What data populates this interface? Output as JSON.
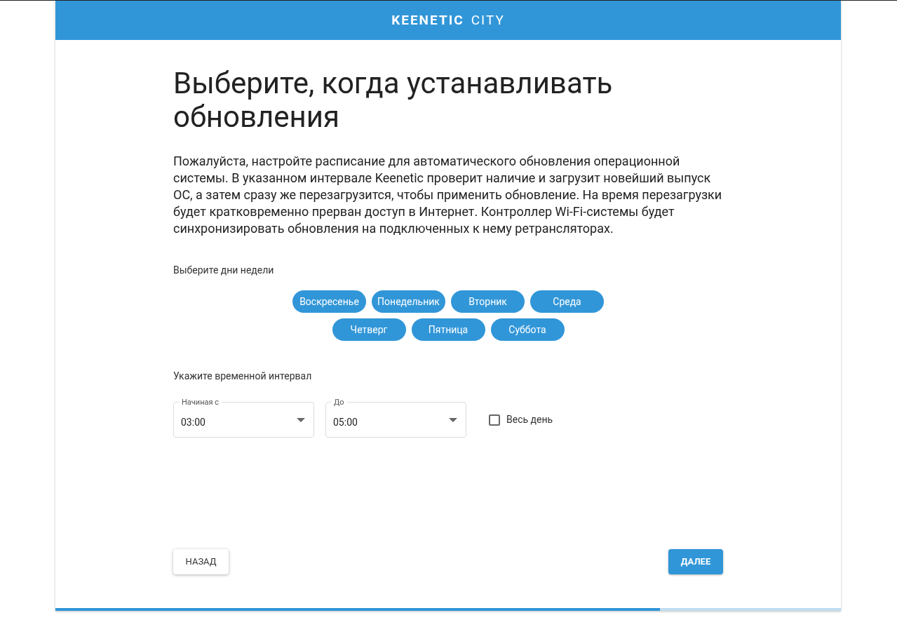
{
  "header": {
    "logo": "KEENETIC",
    "logo_suffix": "CITY"
  },
  "title": "Выберите, когда устанавливать обновления",
  "description": "Пожалуйста, настройте расписание для автоматического обновления операционной системы. В указанном интервале Keenetic проверит наличие и загрузит новейший выпуск ОС, а затем сразу же перезагрузится, чтобы применить обновление. На время перезагрузки будет кратковременно прерван доступ в Интернет. Контроллер Wi-Fi-системы будет синхронизировать обновления на подключенных к нему ретрансляторах.",
  "days_label": "Выберите дни недели",
  "days": [
    {
      "label": "Воскресенье",
      "selected": true
    },
    {
      "label": "Понедельник",
      "selected": true
    },
    {
      "label": "Вторник",
      "selected": true
    },
    {
      "label": "Среда",
      "selected": true
    },
    {
      "label": "Четверг",
      "selected": true
    },
    {
      "label": "Пятница",
      "selected": true
    },
    {
      "label": "Суббота",
      "selected": true
    }
  ],
  "interval_label": "Укажите временной интервал",
  "from": {
    "label": "Начиная с",
    "value": "03:00"
  },
  "to": {
    "label": "До",
    "value": "05:00"
  },
  "all_day": {
    "label": "Весь день",
    "checked": false
  },
  "back_button": "НАЗАД",
  "next_button": "ДАЛЕЕ",
  "progress": {
    "level": 0.77
  }
}
